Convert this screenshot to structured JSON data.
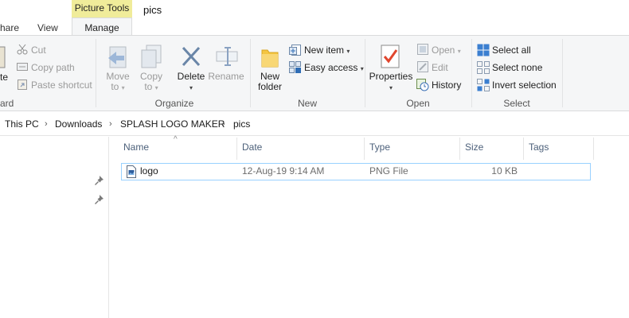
{
  "tabs": {
    "share": "hare",
    "view": "View",
    "context_group": "Picture Tools",
    "manage": "Manage"
  },
  "window": {
    "folder_title": "pics"
  },
  "ribbon": {
    "clipboard": {
      "paste_partial": "te",
      "cut": "Cut",
      "copy_path": "Copy path",
      "paste_shortcut": "Paste shortcut",
      "group_label_partial": "ard"
    },
    "organize": {
      "move_to_line1": "Move",
      "move_to_line2": "to",
      "copy_to_line1": "Copy",
      "copy_to_line2": "to",
      "delete": "Delete",
      "rename": "Rename",
      "group_label": "Organize"
    },
    "new": {
      "new_folder_line1": "New",
      "new_folder_line2": "folder",
      "new_item": "New item",
      "easy_access": "Easy access",
      "group_label": "New"
    },
    "open": {
      "properties": "Properties",
      "open": "Open",
      "edit": "Edit",
      "history": "History",
      "group_label": "Open"
    },
    "select": {
      "select_all": "Select all",
      "select_none": "Select none",
      "invert_selection": "Invert selection",
      "group_label": "Select"
    }
  },
  "address": {
    "crumbs": [
      "This PC",
      "Downloads",
      "SPLASH LOGO MAKER",
      "pics"
    ]
  },
  "columns": {
    "name": "Name",
    "date": "Date",
    "type": "Type",
    "size": "Size",
    "tags": "Tags"
  },
  "files": [
    {
      "name": "logo",
      "date": "12-Aug-19 9:14 AM",
      "type": "PNG File",
      "size": "10 KB",
      "tags": ""
    }
  ],
  "colors": {
    "ribbon_bg": "#f5f6f7",
    "context_tab": "#f0ec9a",
    "selection_border": "#99d1ff",
    "header_text": "#4c607a",
    "disabled_text": "#9a9a9a"
  }
}
